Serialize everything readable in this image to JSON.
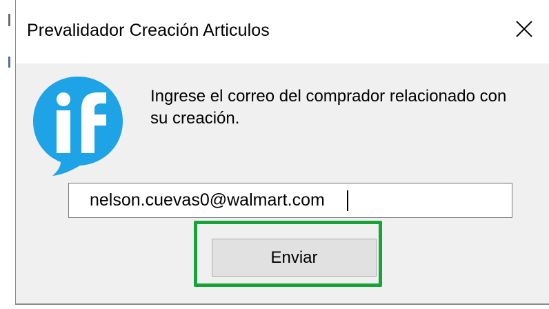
{
  "dialog": {
    "title": "Prevalidador Creación Articulos",
    "close_icon": "close-icon",
    "logo_icon": "if-logo-speech-bubble-icon",
    "message_line1": "Ingrese el correo del comprador relacionado con",
    "message_line2": "su creación.",
    "email_value": "nelson.cuevas0@walmart.com",
    "send_label": "Enviar"
  },
  "colors": {
    "logo_blue": "#1ea3e6",
    "highlight_green": "#17a33a",
    "client_background": "#f0f0f0"
  }
}
